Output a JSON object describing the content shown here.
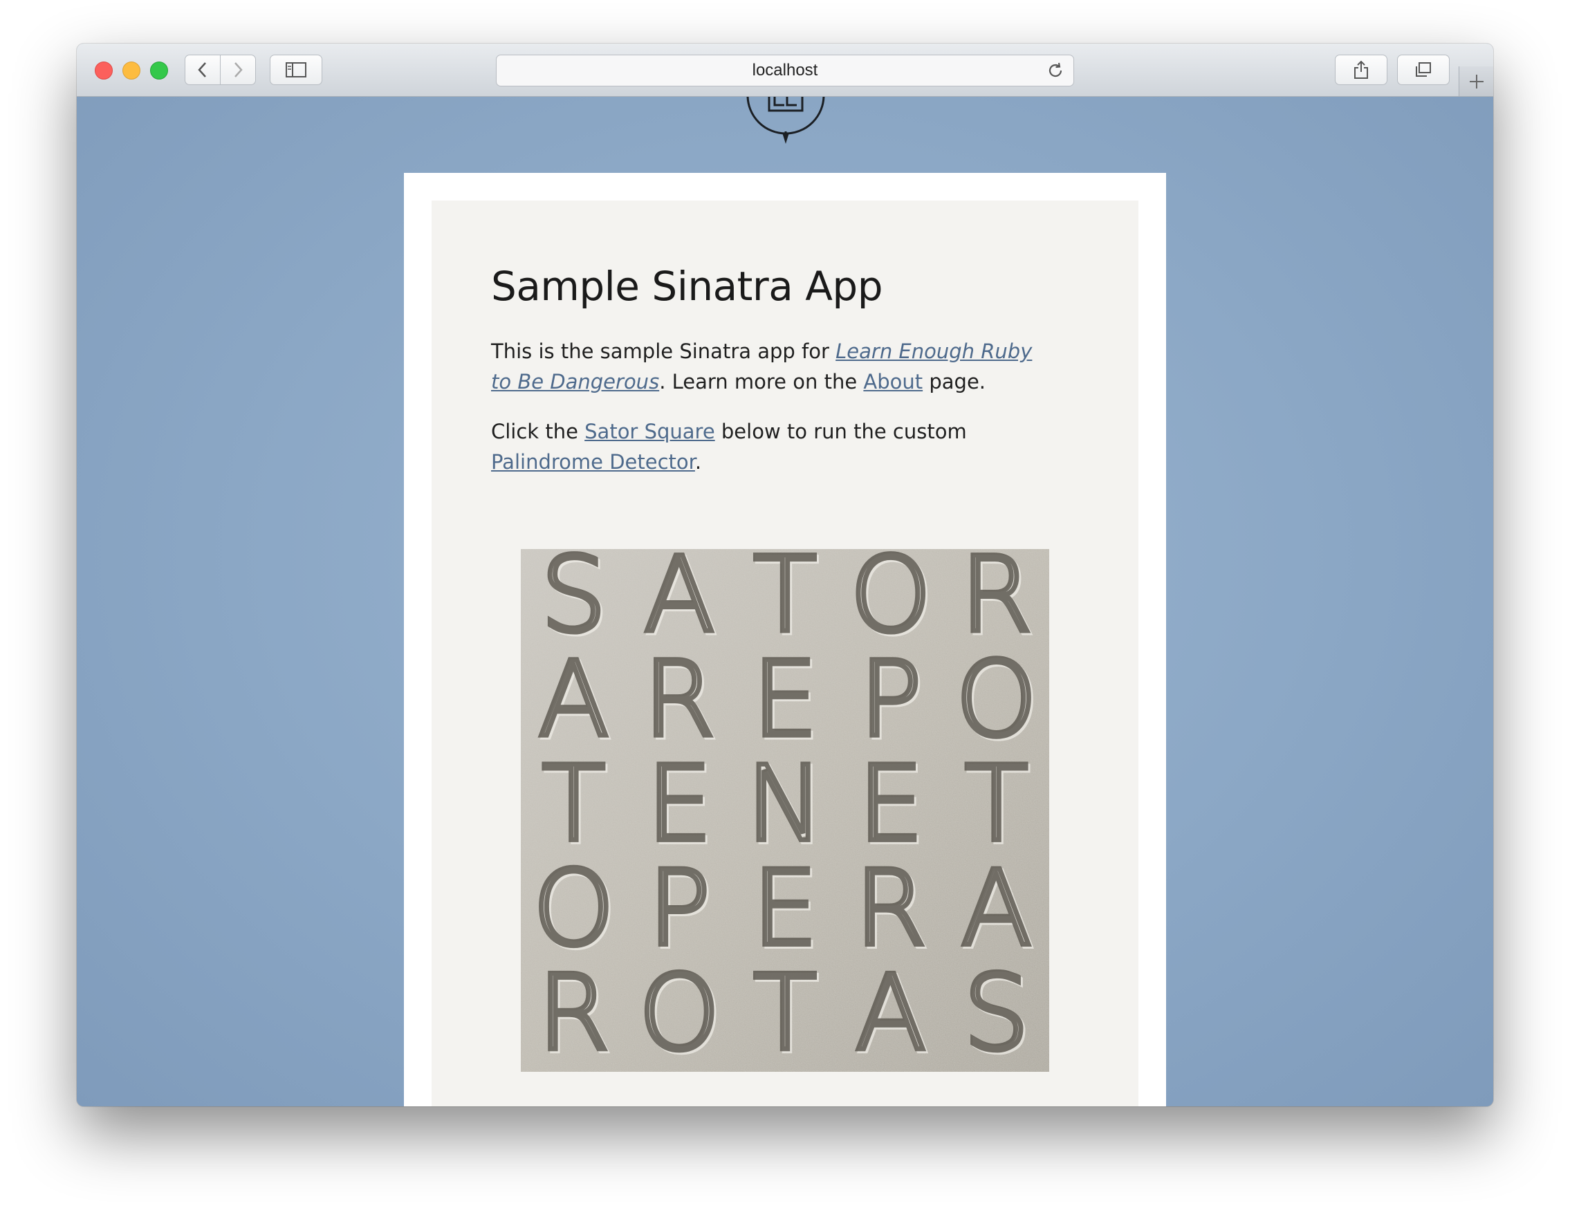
{
  "browser": {
    "address": "localhost"
  },
  "page": {
    "title": "Sample Sinatra App",
    "intro": {
      "text1": "This is the sample Sinatra app for ",
      "link_book": "Learn Enough Ruby to Be Dangerous",
      "text2": ". Learn more on the ",
      "link_about": "About",
      "text3": " page."
    },
    "instruction": {
      "text1": "Click the ",
      "link_sator": "Sator Square",
      "text2": " below to run the custom ",
      "link_palindrome": "Palindrome Detector",
      "text3": "."
    }
  },
  "sator_square": {
    "rows": [
      "SATOR",
      "AREPO",
      "TENET",
      "OPERA",
      "ROTAS"
    ]
  },
  "icons": {
    "back": "chevron-left-icon",
    "forward": "chevron-right-icon",
    "sidebar": "sidebar-icon",
    "reload": "reload-icon",
    "share": "share-icon",
    "tabs": "tabs-icon",
    "new_tab": "plus-icon"
  },
  "colors": {
    "background": "#8ba7c5",
    "card": "#ffffff",
    "content": "#f4f3f0",
    "link": "#4e6a8c"
  }
}
